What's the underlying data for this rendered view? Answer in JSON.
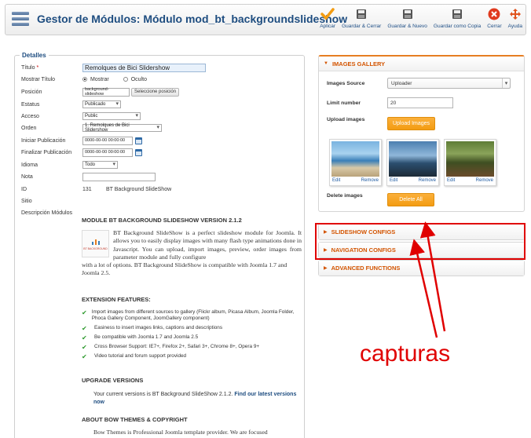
{
  "header": {
    "title": "Gestor de Módulos: Módulo mod_bt_backgroundslideshow",
    "toolbar": [
      {
        "label": "Aplicar",
        "icon": "check-icon"
      },
      {
        "label": "Guardar & Cerrar",
        "icon": "floppy-icon"
      },
      {
        "label": "Guardar & Nuevo",
        "icon": "floppy-icon"
      },
      {
        "label": "Guardar como Copia",
        "icon": "floppy-icon"
      },
      {
        "label": "Cerrar",
        "icon": "close-icon"
      },
      {
        "label": "Ayuda",
        "icon": "help-icon"
      }
    ]
  },
  "details": {
    "legend": "Detalles",
    "titulo_label": "Título",
    "titulo_value": "Remolques de Bici Slidershow",
    "mostrar_label": "Mostrar Título",
    "mostrar_opt1": "Mostrar",
    "mostrar_opt2": "Oculto",
    "posicion_label": "Posición",
    "posicion_value": "background-slideshow",
    "posicion_button": "Seleccione posición",
    "estatus_label": "Estatus",
    "estatus_value": "Publicado",
    "acceso_label": "Acceso",
    "acceso_value": "Public",
    "orden_label": "Orden",
    "orden_value": "1. Remolques de Bici Slidershow",
    "iniciar_label": "Iniciar Publicación",
    "iniciar_value": "0000-00-00 00:00:00",
    "finalizar_label": "Finalizar Publicación",
    "finalizar_value": "0000-00-00 00:00:00",
    "idioma_label": "Idioma",
    "idioma_value": "Todo",
    "nota_label": "Nota",
    "nota_value": "",
    "id_label": "ID",
    "id_value": "131",
    "id_name": "BT Background SlideShow",
    "sitio_label": "Sitio",
    "desc_label": "Descripción Módulos"
  },
  "module": {
    "title": "MODULE BT BACKGROUND SLIDESHOW VERSION 2.1.2",
    "logo_text": "BT BACKGROUND",
    "description": "BT Background SlideShow is a perfect slideshow module for Joomla. It allows you to easily display images with many flash type animations done in Javascript. You can upload, import images, preview, order images from parameter module and fully configure",
    "description2": "with a lot of options. BT Background SlideShow is compatible with Joomla 1.7 and Joomla 2.5.",
    "features_title": "EXTENSION FEATURES:",
    "features": [
      "Import images from different sources to gallery (Flickr album, Picasa Album, Joomla Folder, Phoca Gallery Component, JoomGallery component)",
      "Easiness to insert images links, captions and descriptions",
      "Be compatible with Joomla 1.7 and Joomla 2.5",
      "Cross Browser Support: IE7+, Firefox 2+, Safari 3+, Chrome 8+, Opera 9+",
      "Video tutorial and forum support provided"
    ],
    "upgrade_title": "UPGRADE VERSIONS",
    "upgrade_text": "Your current versions is BT Background SlideShow 2.1.2.",
    "upgrade_link": "Find our latest versions now",
    "about_title": "ABOUT BOW THEMES & COPYRIGHT",
    "about_text": "Bow Themes is Professional Joomla template provider. We are focused"
  },
  "gallery": {
    "header": "IMAGES GALLERY",
    "source_label": "Images Source",
    "source_value": "Uploader",
    "limit_label": "Limit number",
    "limit_value": "20",
    "upload_label": "Upload images",
    "upload_button": "Upload Images",
    "edit_label": "Edit",
    "remove_label": "Remove",
    "delete_label": "Delete images",
    "delete_button": "Delete All"
  },
  "accordions": {
    "slideshow": "SLIDESHOW CONFIGS",
    "navigation": "NAVIGATION CONFIGS",
    "advanced": "ADVANCED FUNCTIONS"
  },
  "annotation": {
    "text": "capturas",
    "color": "#e00000"
  }
}
